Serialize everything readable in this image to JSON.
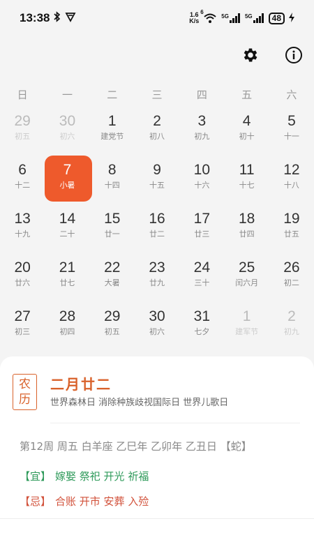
{
  "status_bar": {
    "time": "13:38",
    "net_speed_value": "1.6",
    "net_speed_unit": "K/s",
    "wifi_badge": "6",
    "signal1_label": "5G",
    "signal2_label": "5G",
    "battery": "48"
  },
  "weekdays": [
    "日",
    "一",
    "二",
    "三",
    "四",
    "五",
    "六"
  ],
  "days": [
    {
      "num": "29",
      "sub": "初五",
      "other": true
    },
    {
      "num": "30",
      "sub": "初六",
      "other": true
    },
    {
      "num": "1",
      "sub": "建党节",
      "other": false
    },
    {
      "num": "2",
      "sub": "初八",
      "other": false
    },
    {
      "num": "3",
      "sub": "初九",
      "other": false
    },
    {
      "num": "4",
      "sub": "初十",
      "other": false
    },
    {
      "num": "5",
      "sub": "十一",
      "other": false
    },
    {
      "num": "6",
      "sub": "十二",
      "other": false
    },
    {
      "num": "7",
      "sub": "小暑",
      "other": false,
      "selected": true
    },
    {
      "num": "8",
      "sub": "十四",
      "other": false
    },
    {
      "num": "9",
      "sub": "十五",
      "other": false
    },
    {
      "num": "10",
      "sub": "十六",
      "other": false
    },
    {
      "num": "11",
      "sub": "十七",
      "other": false
    },
    {
      "num": "12",
      "sub": "十八",
      "other": false
    },
    {
      "num": "13",
      "sub": "十九",
      "other": false
    },
    {
      "num": "14",
      "sub": "二十",
      "other": false
    },
    {
      "num": "15",
      "sub": "廿一",
      "other": false
    },
    {
      "num": "16",
      "sub": "廿二",
      "other": false
    },
    {
      "num": "17",
      "sub": "廿三",
      "other": false
    },
    {
      "num": "18",
      "sub": "廿四",
      "other": false
    },
    {
      "num": "19",
      "sub": "廿五",
      "other": false
    },
    {
      "num": "20",
      "sub": "廿六",
      "other": false
    },
    {
      "num": "21",
      "sub": "廿七",
      "other": false
    },
    {
      "num": "22",
      "sub": "大暑",
      "other": false
    },
    {
      "num": "23",
      "sub": "廿九",
      "other": false
    },
    {
      "num": "24",
      "sub": "三十",
      "other": false
    },
    {
      "num": "25",
      "sub": "闰六月",
      "other": false
    },
    {
      "num": "26",
      "sub": "初二",
      "other": false
    },
    {
      "num": "27",
      "sub": "初三",
      "other": false
    },
    {
      "num": "28",
      "sub": "初四",
      "other": false
    },
    {
      "num": "29",
      "sub": "初五",
      "other": false
    },
    {
      "num": "30",
      "sub": "初六",
      "other": false
    },
    {
      "num": "31",
      "sub": "七夕",
      "other": false
    },
    {
      "num": "1",
      "sub": "建军节",
      "other": true
    },
    {
      "num": "2",
      "sub": "初九",
      "other": true
    }
  ],
  "panel": {
    "badge_line1": "农",
    "badge_line2": "历",
    "lunar_date": "二月廿二",
    "festivals": "世界森林日 消除种族歧视国际日 世界儿歌日",
    "info": "第12周  周五 白羊座 乙巳年 乙卯年 乙丑日 【蛇】",
    "yi_label": "【宜】",
    "yi_items": "嫁娶 祭祀 开光 祈福",
    "ji_label": "【忌】",
    "ji_items": "合账 开市 安葬 入殓"
  },
  "colors": {
    "accent": "#ee5a2c",
    "lunar": "#d9622b",
    "yi": "#2e9a5a",
    "ji": "#d2523b"
  },
  "icons": {
    "settings": "gear-icon",
    "info": "info-icon"
  }
}
